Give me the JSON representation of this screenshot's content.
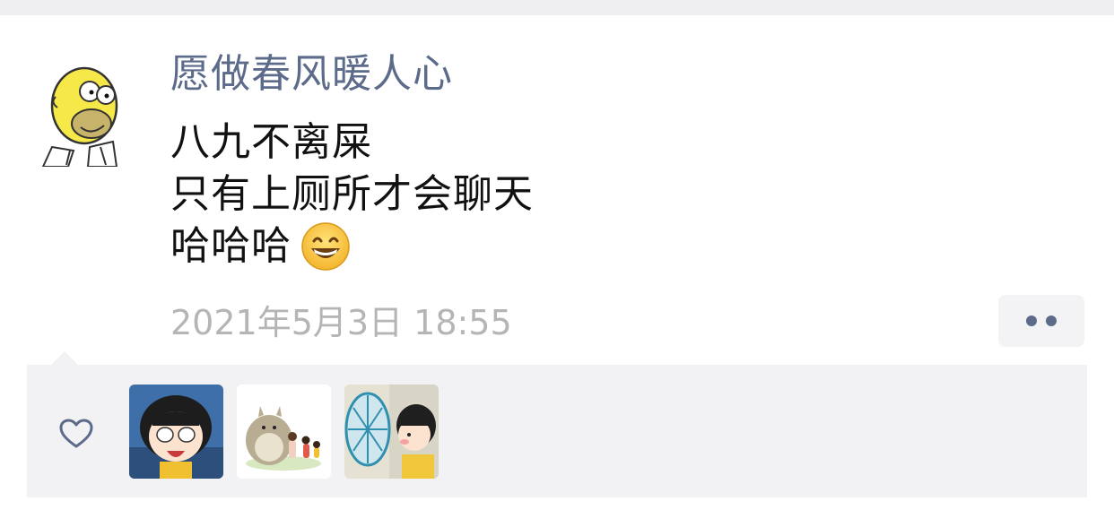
{
  "post": {
    "username": "愿做春风暖人心",
    "lines": [
      "八九不离屎",
      "只有上厕所才会聊天",
      "哈哈哈"
    ],
    "emoji": "grinning-face-emoji",
    "timestamp": "2021年5月3日 18:55"
  },
  "likes": {
    "icon": "heart-outline-icon",
    "avatars": [
      "crying-girl-avatar",
      "totoro-avatar",
      "boy-with-fan-avatar"
    ]
  },
  "colors": {
    "name": "#5c6b8a",
    "timestamp": "#b5b5b5",
    "likes_background": "#f2f2f4"
  }
}
